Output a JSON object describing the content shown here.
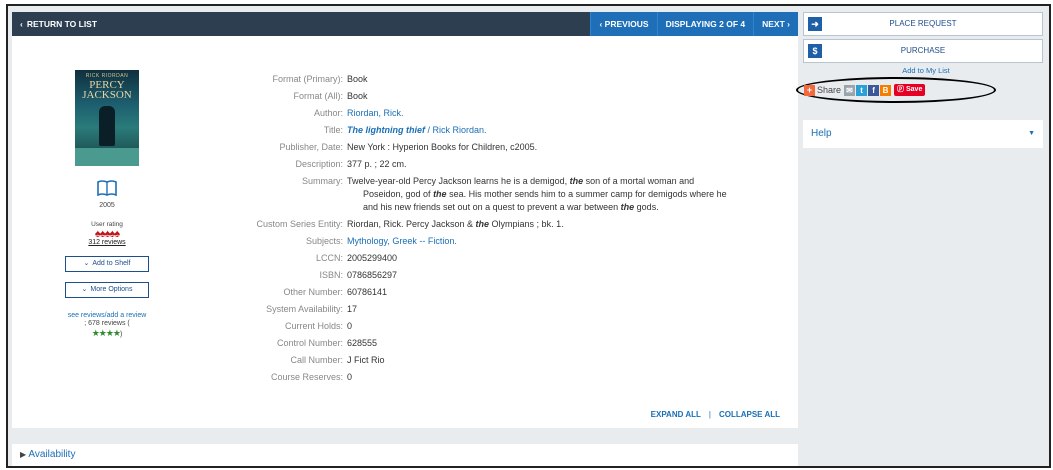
{
  "topbar": {
    "return_label": "RETURN TO LIST",
    "previous_label": "PREVIOUS",
    "displaying_label": "DISPLAYING 2 OF 4",
    "next_label": "NEXT"
  },
  "cover": {
    "author_text": "RICK RIORDAN",
    "title_text": "PERCY JACKSON"
  },
  "left": {
    "year": "2005",
    "user_rating_label": "User rating",
    "rating_icons": "♠♠♠♠♠",
    "reviews_label": "312 reviews",
    "add_to_shelf": "Add to Shelf",
    "more_options": "More Options",
    "see_reviews": "see reviews/add a review",
    "reviews_count": "; 678 reviews (",
    "stars": "★★★★",
    "stars_close": ")"
  },
  "fields": {
    "format_primary_label": "Format (Primary):",
    "format_primary": "Book",
    "format_all_label": "Format (All):",
    "format_all": "Book",
    "author_label": "Author:",
    "author": "Riordan, Rick.",
    "title_label": "Title:",
    "title_italic": "The lightning thief",
    "title_rest": " / Rick Riordan.",
    "publisher_label": "Publisher, Date:",
    "publisher": "New York : Hyperion Books for Children, c2005.",
    "description_label": "Description:",
    "description": "377 p. ; 22 cm.",
    "summary_label": "Summary:",
    "summary_l1a": "Twelve-year-old Percy Jackson learns he is a demigod, ",
    "summary_l1b": "the",
    "summary_l1c": " son of a mortal woman and",
    "summary_l2a": "Poseidon, god of ",
    "summary_l2b": "the",
    "summary_l2c": " sea. His mother sends him to a summer camp for demigods where he",
    "summary_l3a": "and his new friends set out on a quest to prevent a war between ",
    "summary_l3b": "the",
    "summary_l3c": " gods.",
    "series_label": "Custom Series Entity:",
    "series_a": "Riordan, Rick. Percy Jackson & ",
    "series_b": "the",
    "series_c": " Olympians ; bk. 1.",
    "subjects_label": "Subjects:",
    "subjects": "Mythology, Greek -- Fiction.",
    "lccn_label": "LCCN:",
    "lccn": "2005299400",
    "isbn_label": "ISBN:",
    "isbn": "0786856297",
    "other_number_label": "Other Number:",
    "other_number": "60786141",
    "system_availability_label": "System Availability:",
    "system_availability": "17",
    "current_holds_label": "Current Holds:",
    "current_holds": "0",
    "control_number_label": "Control Number:",
    "control_number": "628555",
    "call_number_label": "Call Number:",
    "call_number": "J Fict Rio",
    "course_reserves_label": "Course Reserves:",
    "course_reserves": "0"
  },
  "expand_all": "EXPAND ALL",
  "separator": "|",
  "collapse_all": "COLLAPSE ALL",
  "availability_label": "Availability",
  "side": {
    "place_request": "PLACE REQUEST",
    "purchase": "PURCHASE",
    "add_to_list": "Add to My List",
    "share_label": "Share",
    "save_label": "Save",
    "help_label": "Help"
  },
  "colors": {
    "topbar": "#2c3e50",
    "nav_blue": "#1e6fb8",
    "link": "#1a6fb5",
    "pinterest": "#e60023"
  }
}
